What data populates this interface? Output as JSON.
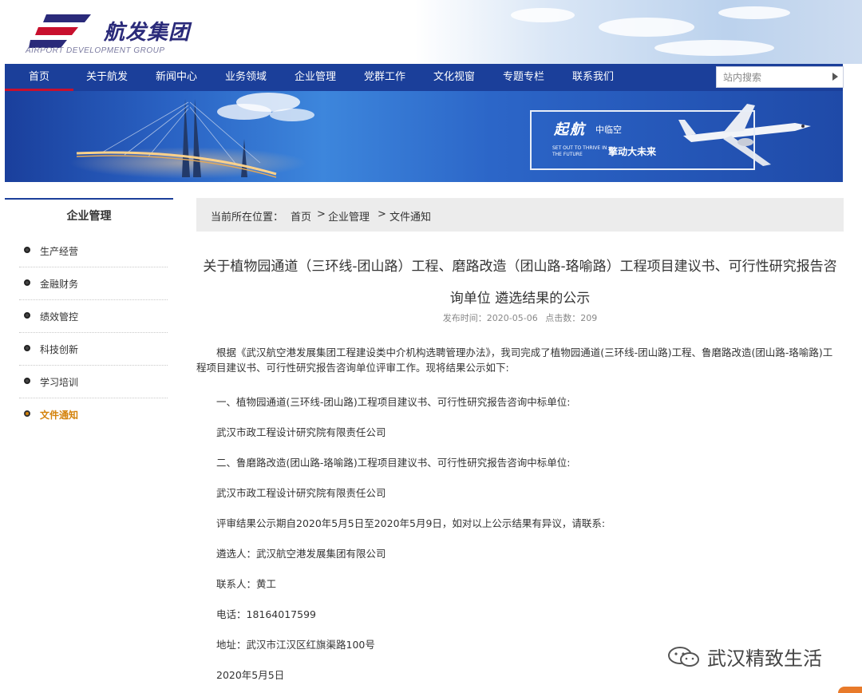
{
  "header": {
    "logo_text": "航发集团",
    "logo_sub": "AIRPORT DEVELOPMENT GROUP"
  },
  "nav": {
    "items": [
      {
        "label": "首页"
      },
      {
        "label": "关于航发"
      },
      {
        "label": "新闻中心"
      },
      {
        "label": "业务领域"
      },
      {
        "label": "企业管理"
      },
      {
        "label": "党群工作"
      },
      {
        "label": "文化视窗"
      },
      {
        "label": "专题专栏"
      },
      {
        "label": "联系我们"
      }
    ],
    "search_placeholder": "站内搜索"
  },
  "banner": {
    "title": "起航",
    "sub1": "中临空",
    "en": "SET OUT TO THRIVE IN THE FUTURE",
    "sub2": "擎动大未来"
  },
  "sidebar": {
    "title": "企业管理",
    "items": [
      {
        "label": "生产经营"
      },
      {
        "label": "金融财务"
      },
      {
        "label": "绩效管控"
      },
      {
        "label": "科技创新"
      },
      {
        "label": "学习培训"
      },
      {
        "label": "文件通知"
      }
    ]
  },
  "breadcrumb": {
    "prefix": "当前所在位置：",
    "items": [
      "首页",
      "企业管理",
      "文件通知"
    ],
    "separator": ">"
  },
  "article": {
    "title_line1": "关于植物园通道（三环线-团山路）工程、磨路改造（团山路-珞喻路）工程项目建议书、可行性研究报告咨",
    "title_line2": "询单位 遴选结果的公示",
    "publish_time": "发布时间：2020-05-06",
    "clicks": "点击数：209",
    "paragraphs": [
      "根据《武汉航空港发展集团工程建设类中介机构选聘管理办法》，我司完成了植物园通道(三环线-团山路)工程、鲁磨路改造(团山路-珞喻路)工程项目建议书、可行性研究报告咨询单位评审工作。现将结果公示如下:",
      "一、植物园通道(三环线-团山路)工程项目建议书、可行性研究报告咨询中标单位:",
      "武汉市政工程设计研究院有限责任公司",
      "二、鲁磨路改造(团山路-珞喻路)工程项目建议书、可行性研究报告咨询中标单位:",
      "武汉市政工程设计研究院有限责任公司",
      "评审结果公示期自2020年5月5日至2020年5月9日，如对以上公示结果有异议，请联系:",
      "遴选人：武汉航空港发展集团有限公司",
      "联系人：黄工",
      "电话：18164017599",
      "地址：武汉市江汉区红旗渠路100号",
      "2020年5月5日"
    ]
  },
  "watermark": {
    "text": "武汉精致生活",
    "icon": "wechat-icon"
  },
  "colors": {
    "nav_bg": "#1b3f9a",
    "active_side": "#d4820a",
    "breadcrumb_bg": "#ececec"
  }
}
